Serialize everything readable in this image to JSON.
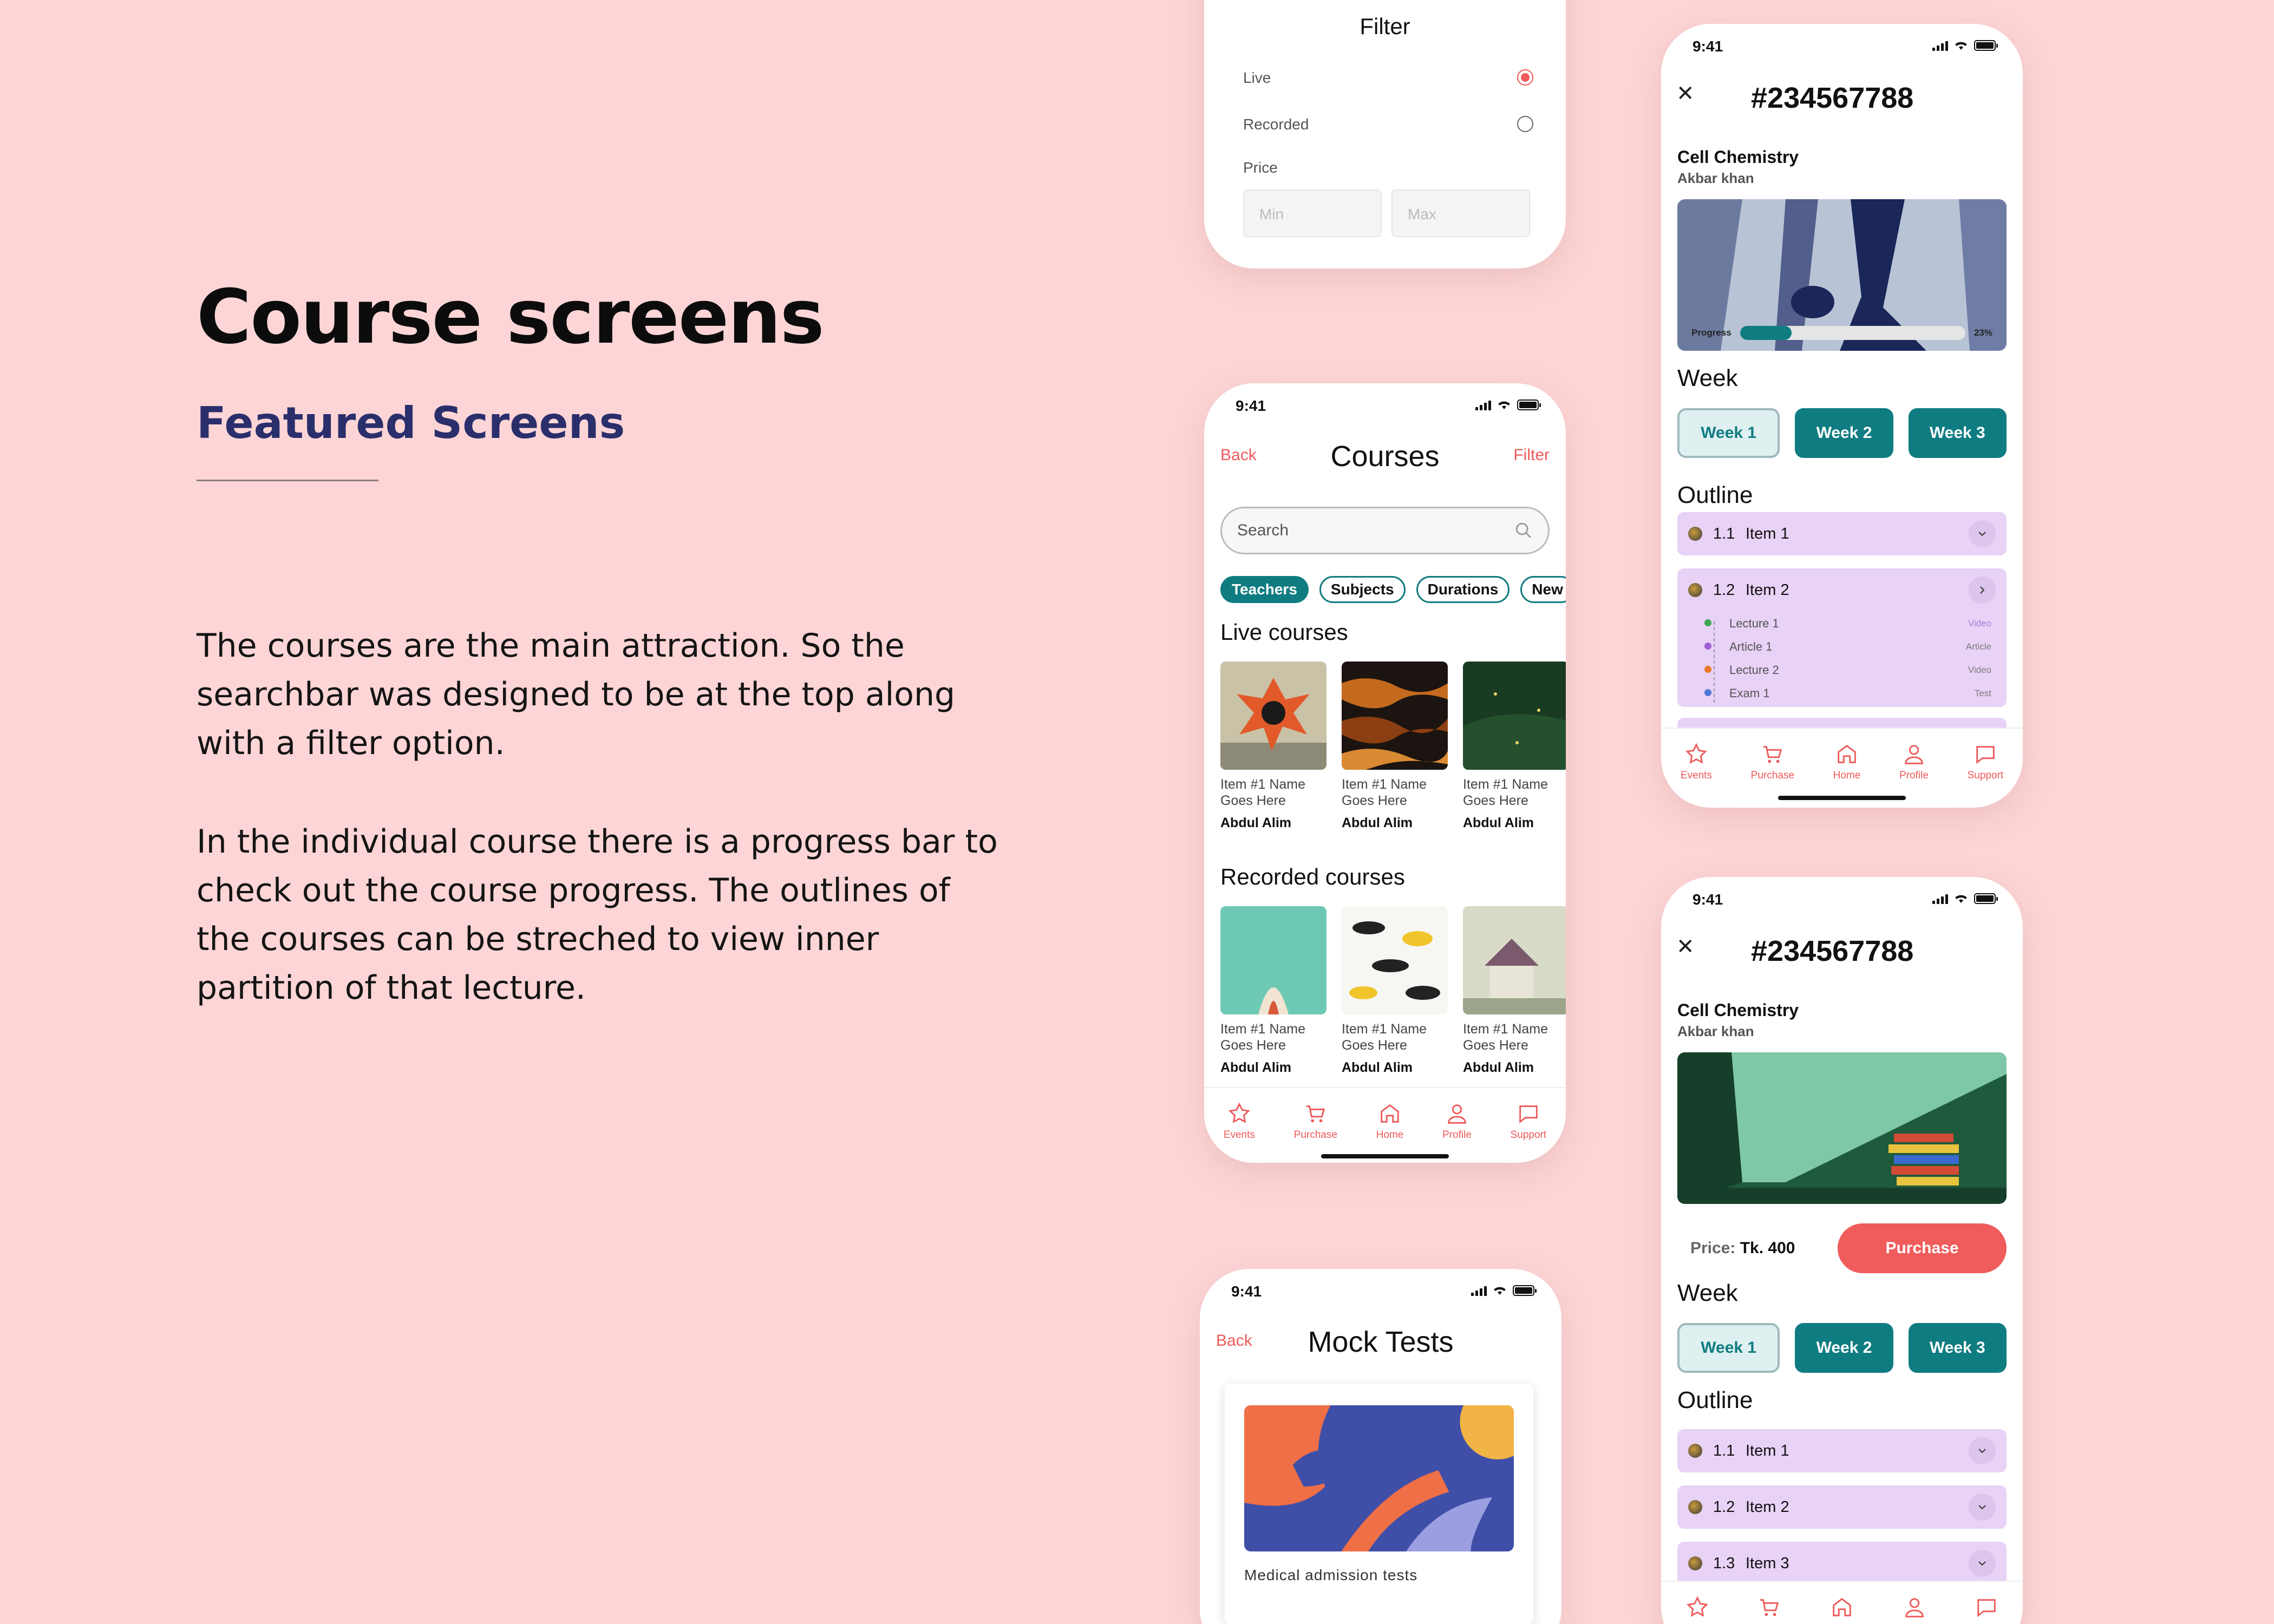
{
  "hero": {
    "title": "Course screens",
    "subtitle": "Featured Screens",
    "paragraph1": "The courses are the main attraction. So the searchbar was designed to be at the top along with a filter option.",
    "paragraph2": "In the individual course there is a progress bar to check out the course progress. The outlines of the courses can be streched to view inner partition of that lecture."
  },
  "status": {
    "time": "9:41"
  },
  "filter": {
    "title": "Filter",
    "live_label": "Live",
    "live_selected": true,
    "recorded_label": "Recorded",
    "recorded_selected": false,
    "price_label": "Price",
    "min_placeholder": "Min",
    "max_placeholder": "Max"
  },
  "courses": {
    "back": "Back",
    "title": "Courses",
    "filter": "Filter",
    "search_placeholder": "Search",
    "chips": [
      {
        "label": "Teachers",
        "selected": true
      },
      {
        "label": "Subjects",
        "selected": false
      },
      {
        "label": "Durations",
        "selected": false
      },
      {
        "label": "New",
        "selected": false
      }
    ],
    "live_title": "Live courses",
    "live": [
      {
        "name": "Item #1 Name Goes Here",
        "author": "Abdul Alim"
      },
      {
        "name": "Item #1 Name Goes Here",
        "author": "Abdul Alim"
      },
      {
        "name": "Item #1 Name Goes Here",
        "author": "Abdul Alim"
      }
    ],
    "recorded_title": "Recorded courses",
    "recorded": [
      {
        "name": "Item #1 Name Goes Here",
        "author": "Abdul Alim"
      },
      {
        "name": "Item #1 Name Goes Here",
        "author": "Abdul Alim"
      },
      {
        "name": "Item #1 Name Goes Here",
        "author": "Abdul Alim"
      }
    ]
  },
  "tabs": [
    "Events",
    "Purchase",
    "Home",
    "Profile",
    "Support"
  ],
  "detail1": {
    "code": "#234567788",
    "course": "Cell Chemistry",
    "teacher": "Akbar khan",
    "progress_label": "Progress",
    "progress_value": "23%",
    "progress_fraction": 0.23,
    "week_heading": "Week",
    "weeks": [
      "Week 1",
      "Week 2",
      "Week 3"
    ],
    "outline_heading": "Outline",
    "items": [
      {
        "num": "1.1",
        "label": "Item 1"
      },
      {
        "num": "1.2",
        "label": "Item 2"
      }
    ],
    "subitems": [
      {
        "label": "Lecture 1",
        "kind": "Video"
      },
      {
        "label": "Article 1",
        "kind": "Article"
      },
      {
        "label": "Lecture 2",
        "kind": "Video"
      },
      {
        "label": "Exam 1",
        "kind": "Test"
      }
    ]
  },
  "detail2": {
    "code": "#234567788",
    "course": "Cell Chemistry",
    "teacher": "Akbar khan",
    "price_label": "Price:",
    "price_value": "Tk. 400",
    "purchase": "Purchase",
    "week_heading": "Week",
    "weeks": [
      "Week 1",
      "Week 2",
      "Week 3"
    ],
    "outline_heading": "Outline",
    "items": [
      {
        "num": "1.1",
        "label": "Item 1"
      },
      {
        "num": "1.2",
        "label": "Item 2"
      },
      {
        "num": "1.3",
        "label": "Item 3"
      }
    ]
  },
  "mock": {
    "back": "Back",
    "title": "Mock Tests",
    "card_label": "Medical admission tests"
  },
  "colors": {
    "accent": "#ef5a5a",
    "teal": "#0f7c81",
    "background": "#fdd5d6",
    "outline_bg": "#e8d2f6",
    "heading": "#2a2f6c"
  }
}
